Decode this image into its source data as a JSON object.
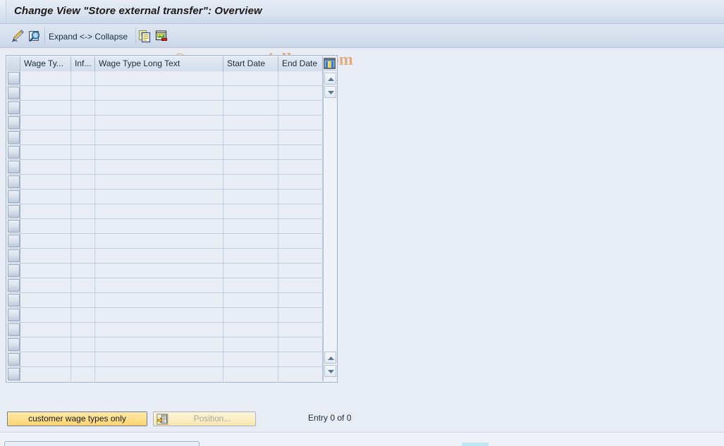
{
  "window": {
    "title": "Change View \"Store external transfer\": Overview"
  },
  "toolbar": {
    "items": [
      {
        "name": "edit-pencil-icon",
        "icon": "pencil-icon",
        "label": ""
      },
      {
        "name": "display-details-icon",
        "icon": "magnifier-details-icon",
        "label": ""
      },
      {
        "name": "expand-collapse-button",
        "icon": "",
        "label": "Expand <-> Collapse"
      },
      {
        "name": "copy-icon",
        "icon": "copy-documents-icon",
        "label": ""
      },
      {
        "name": "layout-variant-icon",
        "icon": "variant-icon",
        "label": ""
      }
    ],
    "expand_collapse_label": "Expand <-> Collapse"
  },
  "watermark": {
    "text": "© www.tutorialkart.com",
    "color": "#e3ab7e"
  },
  "table": {
    "columns": [
      {
        "key": "wage_type",
        "label": "Wage Ty...",
        "width": 72
      },
      {
        "key": "infotype",
        "label": "Inf...",
        "width": 34
      },
      {
        "key": "long_text",
        "label": "Wage Type Long Text",
        "width": 182
      },
      {
        "key": "start_date",
        "label": "Start Date",
        "width": 78
      },
      {
        "key": "end_date",
        "label": "End Date",
        "width": 63
      }
    ],
    "config_icon": "table-settings-icon",
    "row_count": 21,
    "rows": [],
    "scrollbar": {
      "up_icon": "scroll-up-icon",
      "down_icon": "scroll-down-icon"
    }
  },
  "footer": {
    "customer_wage_types_label": "customer wage types only",
    "position_label": "Position...",
    "position_icon": "position-jump-icon",
    "entry_status": "Entry 0 of 0"
  },
  "colors": {
    "background": "#e8edf5",
    "title_bar": "#d8e2ef",
    "accent_yellow": "#ffdf8c",
    "grid_border": "#9fb3cb",
    "text": "#1c2c3d"
  }
}
